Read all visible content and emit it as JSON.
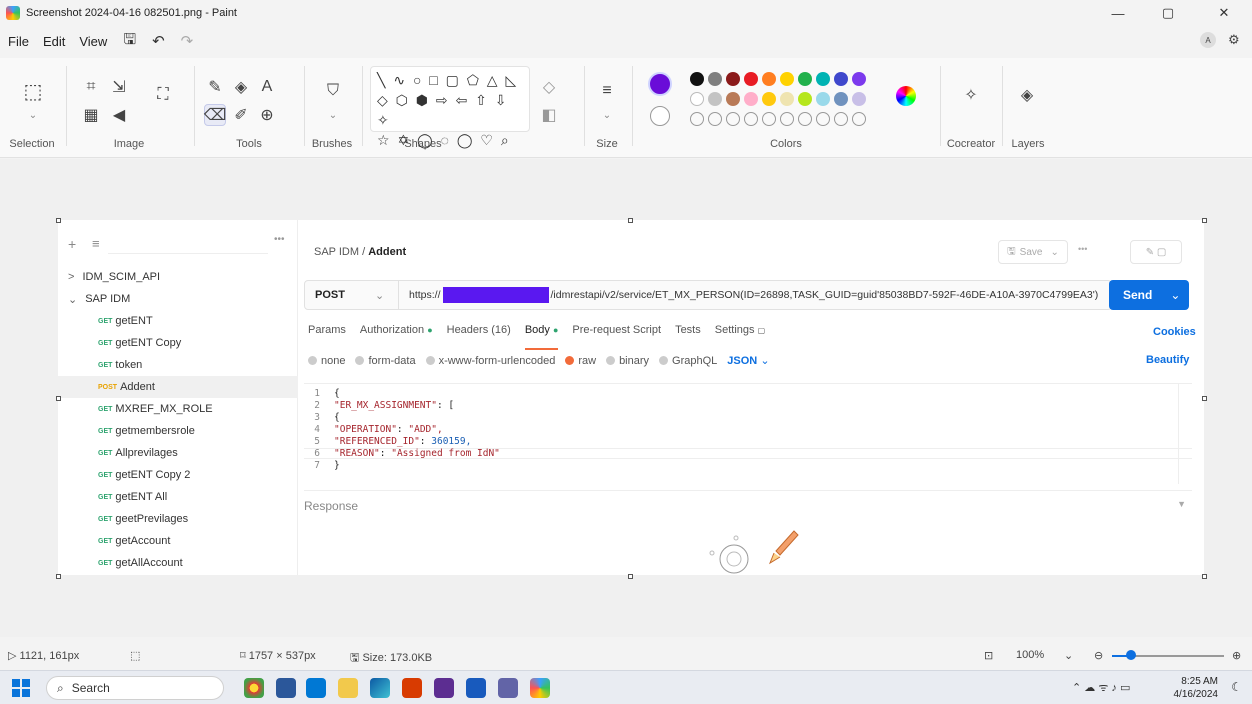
{
  "window": {
    "title": "Screenshot 2024-04-16 082501.png - Paint",
    "minimize": "—",
    "restore": "▢",
    "close": "✕"
  },
  "menu": {
    "items": [
      "File",
      "Edit",
      "View"
    ],
    "save_icon": "save-icon",
    "undo_icon": "undo-icon",
    "redo_icon": "redo-icon",
    "profile_badge": "A",
    "settings_icon": "gear-icon"
  },
  "ribbon": {
    "groups": {
      "selection": "Selection",
      "image": "Image",
      "tools": "Tools",
      "brushes": "Brushes",
      "shapes": "Shapes",
      "size": "Size",
      "colors": "Colors",
      "cocreator": "Cocreator",
      "layers": "Layers"
    },
    "text_tool": "A",
    "shapes_rows": [
      "╲ ∿ ○ □ ▢ ⬠ △ ◺",
      "◇ ⬡ ⬢ ⇨ ⇦ ⇧ ⇩ ✧",
      "☆ ✡ ◯ ◌ ◯ ♡ ⌕"
    ],
    "primary_color": "#6a0dd8",
    "color_row1": [
      "#111111",
      "#7f7f7f",
      "#8b1a1a",
      "#e81c24",
      "#ff7e20",
      "#ffd200",
      "#22b14c",
      "#00b3b3",
      "#3f48cc",
      "#7c3aed"
    ],
    "color_row2": [
      "#ffffff",
      "#c3c3c3",
      "#b97a57",
      "#ffaec9",
      "#ffc90e",
      "#efe4b0",
      "#b5e61d",
      "#99d9ea",
      "#7092be",
      "#c8bfe7"
    ]
  },
  "postman": {
    "sidebar": {
      "collections": [
        {
          "label": "IDM_SCIM_API",
          "chevron": ">"
        },
        {
          "label": "SAP IDM",
          "chevron": "⌄"
        }
      ],
      "requests": [
        {
          "method": "GET",
          "label": "getENT"
        },
        {
          "method": "GET",
          "label": "getENT Copy"
        },
        {
          "method": "GET",
          "label": "token"
        },
        {
          "method": "POST",
          "label": "Addent"
        },
        {
          "method": "GET",
          "label": "MXREF_MX_ROLE"
        },
        {
          "method": "GET",
          "label": "getmembersrole"
        },
        {
          "method": "GET",
          "label": "Allprevilages"
        },
        {
          "method": "GET",
          "label": "getENT Copy 2"
        },
        {
          "method": "GET",
          "label": "getENT All"
        },
        {
          "method": "GET",
          "label": "geetPrevilages"
        },
        {
          "method": "GET",
          "label": "getAccount"
        },
        {
          "method": "GET",
          "label": "getAllAccount"
        }
      ]
    },
    "breadcrumb": {
      "parent": "SAP IDM",
      "sep": "/",
      "current": "Addent"
    },
    "save_label": "Save",
    "request": {
      "method": "POST",
      "url_prefix": "https://",
      "url_suffix": "/idmrestapi/v2/service/ET_MX_PERSON(ID=26898,TASK_GUID=guid'85038BD7-592F-46DE-A10A-3970C4799EA3')",
      "send_label": "Send"
    },
    "tabs": [
      "Params",
      "Authorization",
      "Headers (16)",
      "Body",
      "Pre-request Script",
      "Tests",
      "Settings"
    ],
    "cookies": "Cookies",
    "body_types": [
      "none",
      "form-data",
      "x-www-form-urlencoded",
      "raw",
      "binary",
      "GraphQL"
    ],
    "format": "JSON",
    "beautify": "Beautify",
    "code": {
      "l1": "{",
      "l2_key": "\"ER_MX_ASSIGNMENT\"",
      "l2_rest": ": [",
      "l3": "{",
      "l4_key": "\"OPERATION\"",
      "l4_val": "\"ADD\",",
      "l5_key": "\"REFERENCED_ID\"",
      "l5_val": "360159,",
      "l6_key": "\"REASON\"",
      "l6_val": "\"Assigned from IdN\"",
      "l7": "}"
    },
    "response_label": "Response"
  },
  "status": {
    "cursor_pos": "1121, 161px",
    "image_size": "1757 × 537px",
    "file_size": "Size: 173.0KB",
    "zoom": "100%"
  },
  "taskbar": {
    "search_placeholder": "Search",
    "time": "8:25 AM",
    "date": "4/16/2024"
  }
}
